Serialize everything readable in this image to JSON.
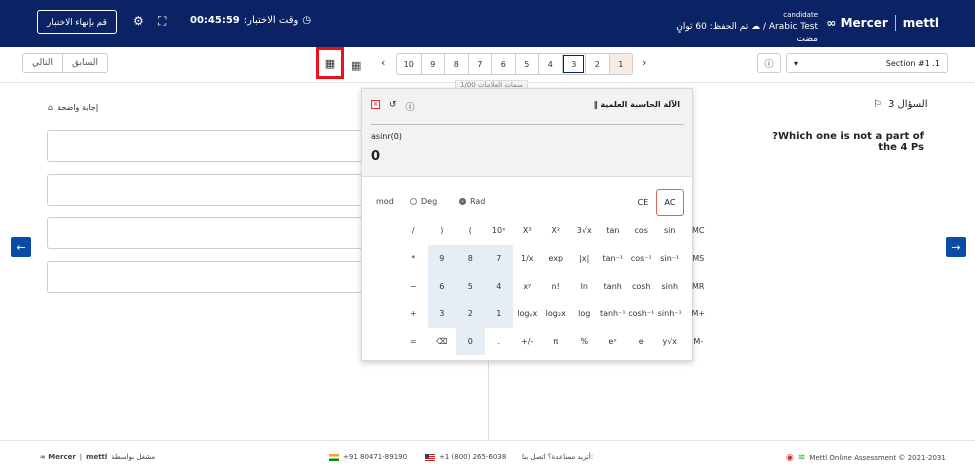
{
  "header": {
    "brand_mercer": "Mercer",
    "brand_mettl": "mettl",
    "candidate_label": "candidate",
    "save_status": "تم الحفظ: 60 ثوانٍ مضت",
    "test_name": "Arabic Test",
    "separator": "/",
    "timer_label": "وقت الاختبار:",
    "timer_value": "00:45:59",
    "end_test_button": "قم بإنهاء الاختبار"
  },
  "nav": {
    "prev_label": "السابق",
    "next_label": "التالي",
    "pages": [
      "10",
      "9",
      "8",
      "7",
      "6",
      "5",
      "4",
      "3",
      "2",
      "1"
    ],
    "current_page": "3",
    "visited_page": "1",
    "section_label": "Section #1 .1",
    "behind_text": "سمات العلامات 1/00"
  },
  "question": {
    "title": "السؤال 3",
    "text": "?Which one is not a part of the 4 Ps",
    "clear_label": "إجابة واضحة"
  },
  "calculator": {
    "title": "الآلة الحاسبة العلمية",
    "expression": "asinr(0)",
    "result": "0",
    "mod": "mod",
    "deg": "Deg",
    "rad": "Rad",
    "ce": "CE",
    "ac": "AC",
    "rows": [
      [
        "/",
        ")",
        "(",
        "10ˣ",
        "X³",
        "X²",
        "3√x",
        "tan",
        "cos",
        "sin",
        "MC"
      ],
      [
        "*",
        "9",
        "8",
        "7",
        "1/x",
        "exp",
        "|x|",
        "tan⁻¹",
        "cos⁻¹",
        "sin⁻¹",
        "MS"
      ],
      [
        "−",
        "6",
        "5",
        "4",
        "xʸ",
        "n!",
        "ln",
        "tanh",
        "cosh",
        "sinh",
        "MR"
      ],
      [
        "+",
        "3",
        "2",
        "1",
        "logᵧx",
        "log₂x",
        "log",
        "tanh⁻¹",
        "cosh⁻¹",
        "sinh⁻¹",
        "M+"
      ],
      [
        "=",
        "⌫",
        "0",
        ".",
        "+/-",
        "π",
        "%",
        "eˣ",
        "e",
        "y√x",
        "M-"
      ]
    ]
  },
  "footer": {
    "powered": "مشغل بواسطة",
    "mercer": "Mercer",
    "mettl": "mettl",
    "phone_in": "+91 80471-89190",
    "phone_us": "+1 (800) 265-6038",
    "help": "أتريد مساعدة؟ اتصل بنا:",
    "copyright": "Mettl Online Assessment © 2021-2031"
  }
}
